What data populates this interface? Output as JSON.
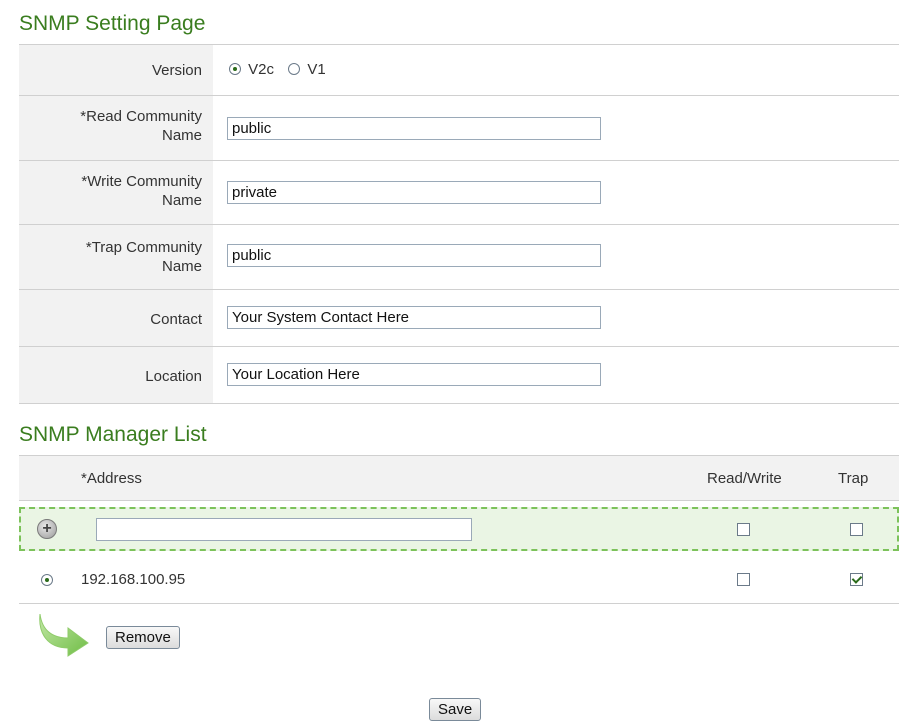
{
  "settings_section": {
    "title": "SNMP Setting Page",
    "version": {
      "label": "Version",
      "options": [
        "V2c",
        "V1"
      ],
      "selected": "V2c"
    },
    "read_community": {
      "label_line1": "*Read Community",
      "label_line2": "Name",
      "value": "public"
    },
    "write_community": {
      "label_line1": "*Write Community",
      "label_line2": "Name",
      "value": "private"
    },
    "trap_community": {
      "label_line1": "*Trap Community",
      "label_line2": "Name",
      "value": "public"
    },
    "contact": {
      "label": "Contact",
      "value": "Your System Contact Here"
    },
    "location": {
      "label": "Location",
      "value": "Your Location Here"
    }
  },
  "manager_section": {
    "title": "SNMP Manager List",
    "columns": {
      "address": "*Address",
      "read_write": "Read/Write",
      "trap": "Trap"
    },
    "new_entry": {
      "address": "",
      "read_write": false,
      "trap": false
    },
    "managers": [
      {
        "address": "192.168.100.95",
        "selected": true,
        "read_write": false,
        "trap": true
      }
    ],
    "remove_label": "Remove"
  },
  "save_label": "Save",
  "colors": {
    "accent": "#3a7d1f",
    "add_row_border": "#7cc25a",
    "add_row_bg": "#eaf5e4",
    "label_bg": "#f2f2f2"
  },
  "icons": {
    "add": "plus-circle-icon",
    "arrow": "curved-arrow-icon"
  }
}
